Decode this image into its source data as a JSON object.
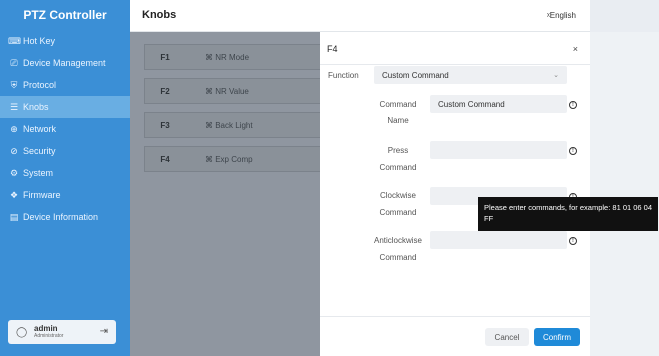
{
  "app_title": "PTZ Controller",
  "sidebar": {
    "items": [
      {
        "label": "Hot Key",
        "icon": "keyboard-icon",
        "glyph": "⌨"
      },
      {
        "label": "Device Management",
        "icon": "device-icon",
        "glyph": "⎚"
      },
      {
        "label": "Protocol",
        "icon": "shield-icon",
        "glyph": "⛨"
      },
      {
        "label": "Knobs",
        "icon": "knobs-icon",
        "glyph": "☰"
      },
      {
        "label": "Network",
        "icon": "globe-icon",
        "glyph": "⊕"
      },
      {
        "label": "Security",
        "icon": "security-icon",
        "glyph": "⊘"
      },
      {
        "label": "System",
        "icon": "gear-icon",
        "glyph": "⚙"
      },
      {
        "label": "Firmware",
        "icon": "firmware-icon",
        "glyph": "❖"
      },
      {
        "label": "Device Information",
        "icon": "info-icon",
        "glyph": "▤"
      }
    ]
  },
  "user": {
    "name": "admin",
    "role": "Administrator"
  },
  "header": {
    "title": "Knobs",
    "lang": "”å English"
  },
  "knobs": [
    {
      "key": "F1",
      "func": "⌘ NR Mode"
    },
    {
      "key": "F2",
      "func": "⌘ NR Value"
    },
    {
      "key": "F3",
      "func": "⌘ Back Light"
    },
    {
      "key": "F4",
      "func": "⌘ Exp Comp"
    }
  ],
  "panel": {
    "title": "F4",
    "close": "×",
    "function_label": "Function",
    "function_value": "Custom Command",
    "command_name_label_1": "Command",
    "command_name_label_2": "Name",
    "command_name_value": "Custom Command",
    "press_label_1": "Press",
    "press_label_2": "Command",
    "press_value": "",
    "cw_label_1": "Clockwise",
    "cw_label_2": "Command",
    "cw_value": "",
    "acw_label_1": "Anticlockwise",
    "acw_label_2": "Command",
    "acw_value": "",
    "cancel": "Cancel",
    "confirm": "Confirm"
  },
  "tooltip": "Please enter commands, for example: 81 01 06 04 FF",
  "colors": {
    "sidebar": "#3b8fd6",
    "active": "#69aee3",
    "accent": "#1f8ad8"
  }
}
